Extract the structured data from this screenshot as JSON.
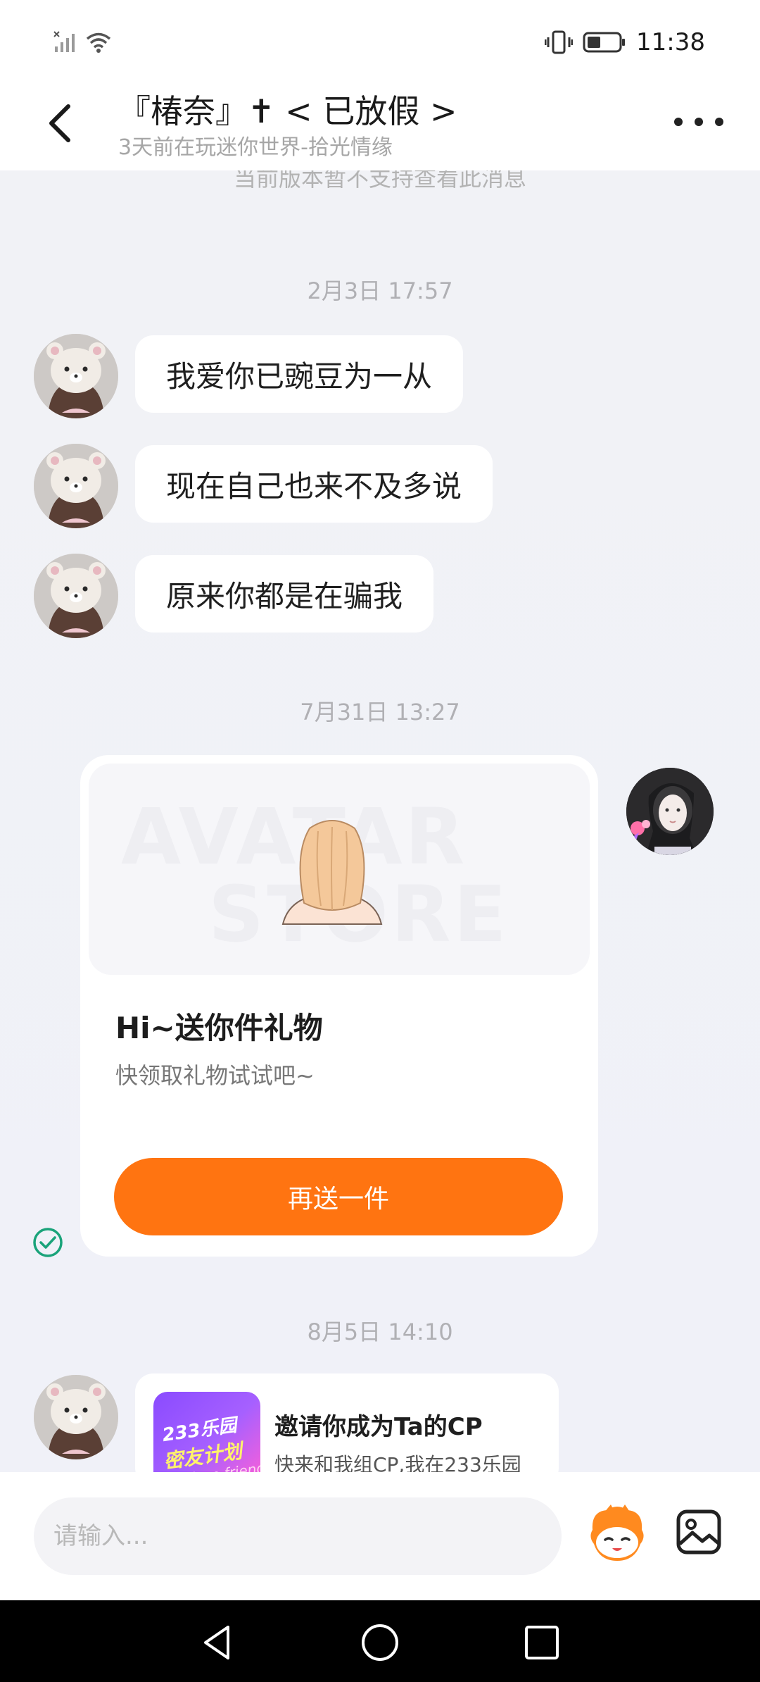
{
  "status_bar": {
    "time": "11:38"
  },
  "header": {
    "back_icon": "chevron-left-icon",
    "title": "『椿奈』✝︎ < 已放假 >",
    "subtitle": "3天前在玩迷你世界-拾光情缘",
    "more_icon": "more-dots-icon"
  },
  "chat": {
    "unsupported_notice": "当前版本暂不支持查看此消息",
    "timestamps": [
      "2月3日 17:57",
      "7月31日 13:27",
      "8月5日 14:10"
    ],
    "messages": [
      {
        "text": "我爱你已豌豆为一从"
      },
      {
        "text": "现在自己也来不及多说"
      },
      {
        "text": "原来你都是在骗我"
      }
    ],
    "gift_card": {
      "watermark_line1": "AVATAR",
      "watermark_line2": "STORE",
      "title": "Hi~送你件礼物",
      "subtitle": "快领取礼物试试吧~",
      "button": "再送一件"
    },
    "cp_card": {
      "thumb_line1": "233乐园",
      "thumb_line2": "密友计划",
      "thumb_line3": "Close friend",
      "title": "邀请你成为Ta的CP",
      "subtitle": "快来和我组CP,我在233乐园"
    }
  },
  "input_bar": {
    "placeholder": "请输入..."
  },
  "colors": {
    "accent": "#ff7411",
    "bubble": "#ffffff",
    "background": "#f1f2f7",
    "check": "#1aa37a"
  }
}
